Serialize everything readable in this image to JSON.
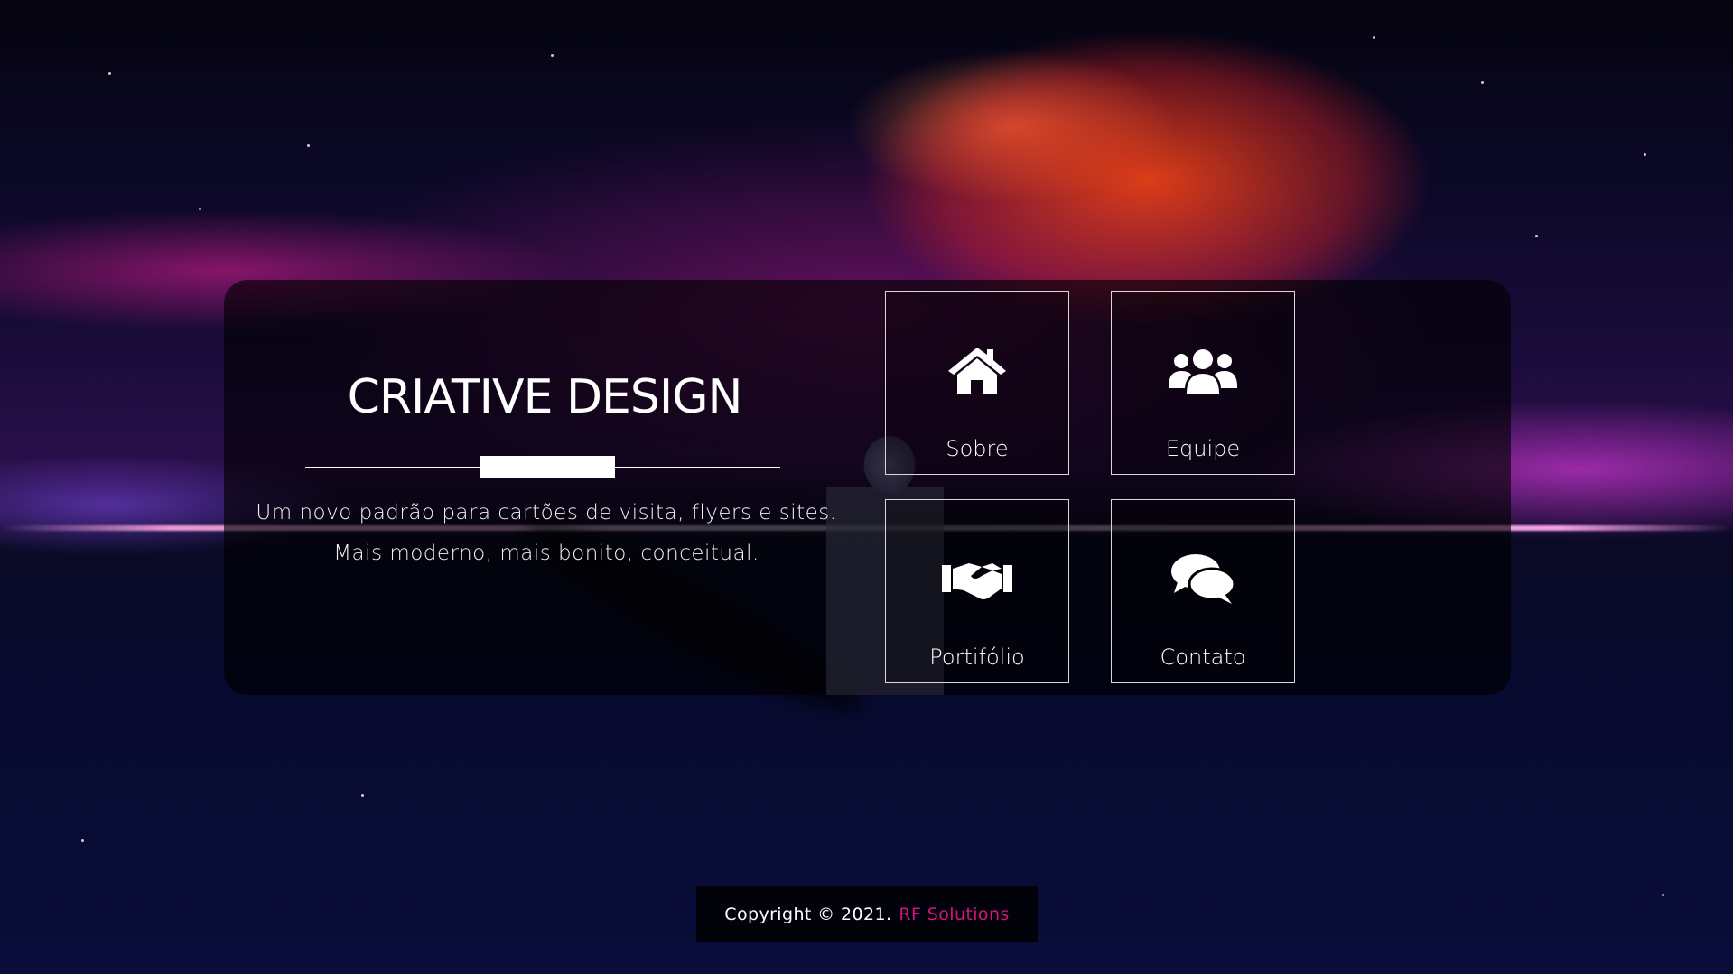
{
  "hero": {
    "title": "CRIATIVE DESIGN",
    "tagline_line1": "Um novo padrão para cartões de visita, flyers e sites.",
    "tagline_line2": "Mais moderno, mais bonito, conceitual."
  },
  "menu": {
    "items": [
      {
        "label": "Sobre",
        "icon": "home-icon"
      },
      {
        "label": "Equipe",
        "icon": "users-icon"
      },
      {
        "label": "Portifólio",
        "icon": "handshake-icon"
      },
      {
        "label": "Contato",
        "icon": "chat-icon"
      }
    ]
  },
  "footer": {
    "copyright": "Copyright © 2021.",
    "brand": "RF Solutions",
    "brand_color": "#d4147d"
  }
}
